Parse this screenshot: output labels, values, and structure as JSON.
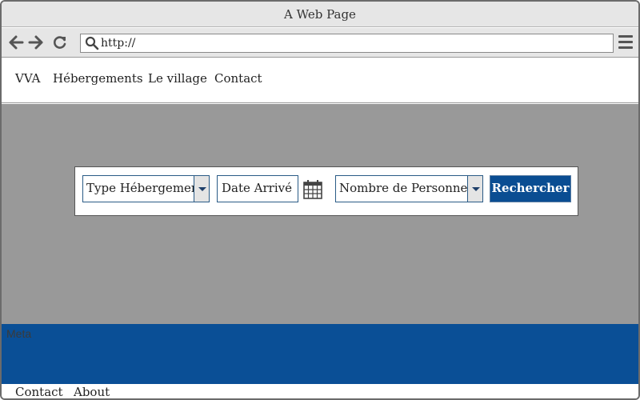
{
  "browser": {
    "title": "A Web Page",
    "url": "http://"
  },
  "site_nav": {
    "items": [
      "VVA",
      "Hébergements",
      "Le village",
      "Contact"
    ]
  },
  "search_form": {
    "type_select_value": "Type Hébergement",
    "date_placeholder": "Date Arrivé",
    "persons_select_value": "Nombre de Personnes",
    "submit_label": "Rechercher"
  },
  "footer": {
    "meta_label": "Meta",
    "links": [
      "Contact",
      "About"
    ]
  },
  "colors": {
    "accent": "#0a4d92",
    "hero_bg": "#999999",
    "chrome_bg": "#e6e6e6"
  }
}
